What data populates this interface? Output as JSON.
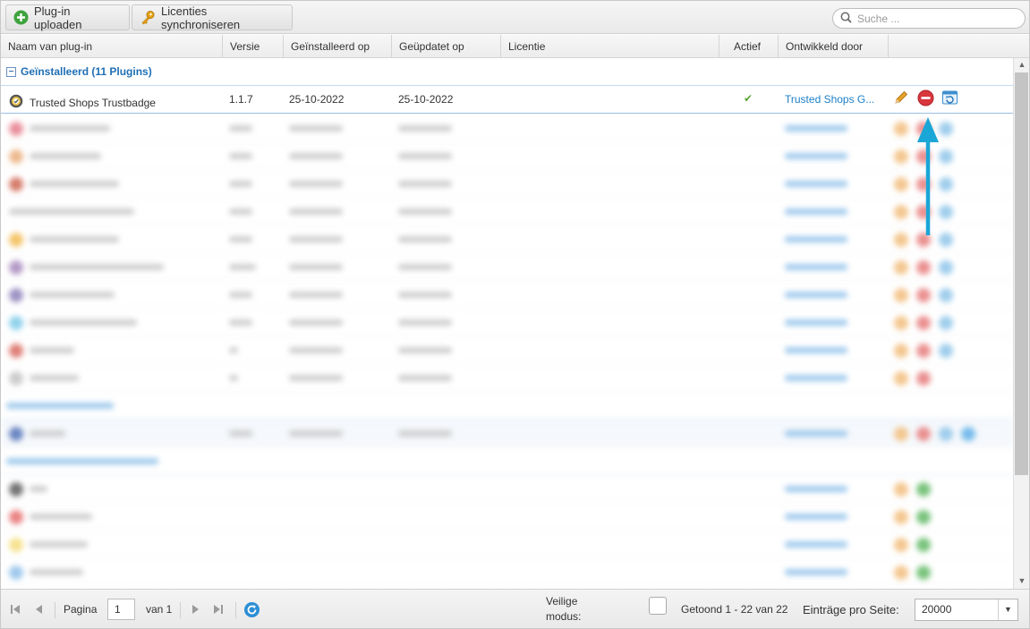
{
  "toolbar": {
    "upload_label": "Plug-in uploaden",
    "sync_label": "Licenties synchroniseren",
    "search_placeholder": "Suche ..."
  },
  "columns": [
    "Naam van plug-in",
    "Versie",
    "Geïnstalleerd op",
    "Geüpdatet op",
    "Licentie",
    "Actief",
    "Ontwikkeld door"
  ],
  "group_installed": "Geïnstalleerd (11 Plugins)",
  "selected_row": {
    "name": "Trusted Shops Trustbadge",
    "version": "1.1.7",
    "installed": "25-10-2022",
    "updated": "25-10-2022",
    "license": "",
    "active": "✔",
    "developer": "Trusted Shops G..."
  },
  "colors": {
    "accent": "#1b7fc7",
    "arrow": "#1aa6d6",
    "active_check": "#5aa532",
    "uninstall": "#d9363e",
    "edit": "#e6a12a"
  },
  "pager": {
    "page_label": "Pagina",
    "page_value": "1",
    "of_label": "van 1",
    "safe_mode_label_1": "Veilige",
    "safe_mode_label_2": "modus:",
    "shown": "Getoond 1 - 22 van 22",
    "per_page_label": "Einträge pro Seite:",
    "per_page_value": "20000"
  }
}
